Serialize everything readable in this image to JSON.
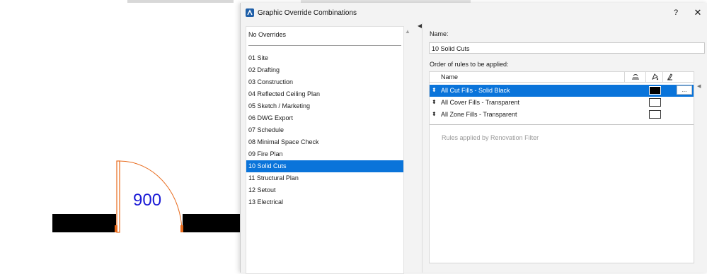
{
  "colors": {
    "accent": "#0a74da",
    "dimension_text": "#1b1bd6",
    "door_line": "#e86a1c",
    "wall": "#000000"
  },
  "drawing": {
    "dimension": "900"
  },
  "dialog": {
    "title": "Graphic Override Combinations",
    "help_label": "?",
    "close_label": "✕",
    "combinations": {
      "top_item": "No Overrides",
      "items": [
        "01 Site",
        "02 Drafting",
        "03 Construction",
        "04 Reflected Ceiling Plan",
        "05 Sketch / Marketing",
        "06 DWG Export",
        "07 Schedule",
        "08 Minimal Space Check",
        "09 Fire Plan",
        "10 Solid Cuts",
        "11 Structural Plan",
        "12 Setout",
        "13 Electrical"
      ],
      "selected": "10 Solid Cuts"
    },
    "name_label": "Name:",
    "name_value": "10 Solid Cuts",
    "order_label": "Order of rules to be applied:",
    "rules_header": {
      "name": "Name",
      "col1_icon": "renovation-icon",
      "col2_icon": "fill-override-icon",
      "col3_icon": "pen-override-icon"
    },
    "rules": [
      {
        "name": "All Cut Fills - Solid Black",
        "swatch": "black",
        "more": "...",
        "selected": true
      },
      {
        "name": "All Cover Fills - Transparent",
        "swatch": "white",
        "selected": false
      },
      {
        "name": "All Zone Fills - Transparent",
        "swatch": "white",
        "selected": false
      }
    ],
    "renovation_note": "Rules applied by Renovation Filter"
  }
}
